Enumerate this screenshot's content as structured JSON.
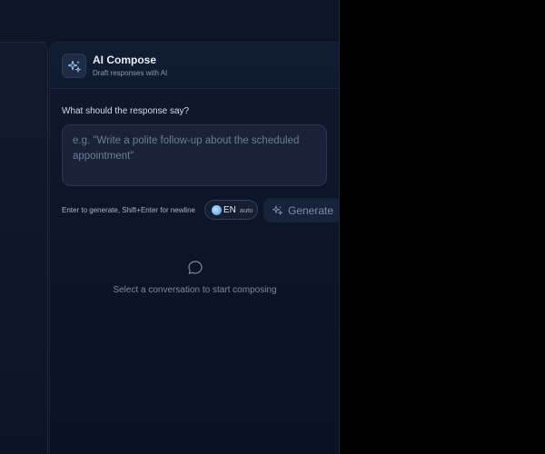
{
  "compose": {
    "title": "AI Compose",
    "subtitle": "Draft responses with AI",
    "header_icon": "sparkles-icon",
    "prompt_label": "What should the response say?",
    "prompt_value": "",
    "prompt_placeholder": "e.g. \"Write a polite follow-up about the scheduled appointment\"",
    "hint": "Enter to generate, Shift+Enter for newline",
    "language": {
      "icon": "globe-icon",
      "code": "EN",
      "mode": "auto"
    },
    "generate_button": {
      "icon": "sparkles-icon",
      "label": "Generate"
    },
    "empty_state": {
      "icon": "chat-bubble-icon",
      "text": "Select a conversation to start composing"
    }
  },
  "colors": {
    "background": "#0b1424",
    "panel_header": "#111d33",
    "text_primary": "#e8edf7",
    "text_muted": "#7d89a1",
    "accent": "#7fb8f0"
  }
}
